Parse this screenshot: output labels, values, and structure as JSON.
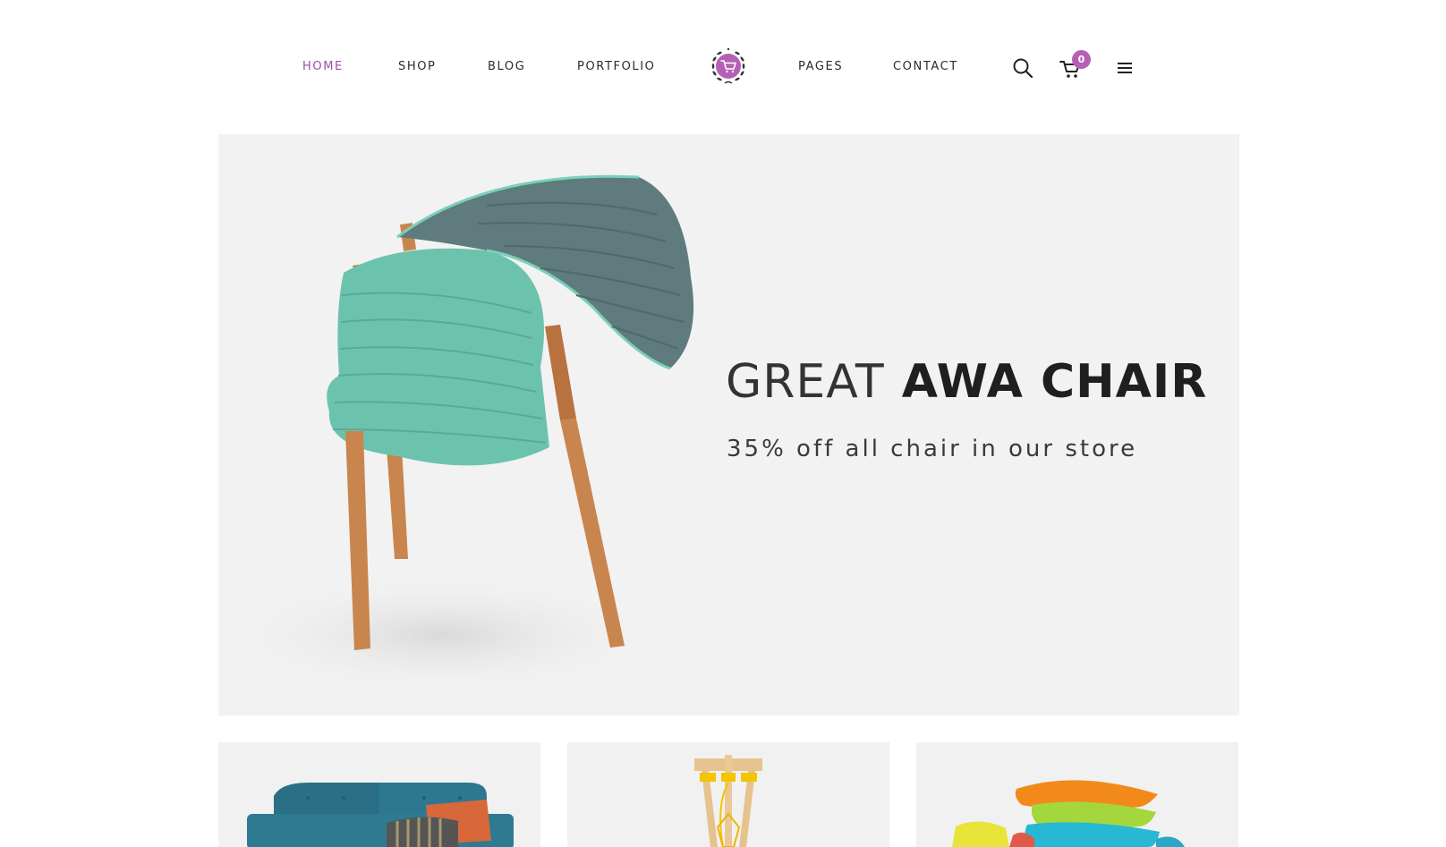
{
  "nav": {
    "left": [
      {
        "label": "HOME",
        "active": true
      },
      {
        "label": "SHOP"
      },
      {
        "label": "BLOG"
      },
      {
        "label": "PORTFOLIO"
      }
    ],
    "right": [
      {
        "label": "PAGES"
      },
      {
        "label": "CONTACT"
      }
    ],
    "logo_icon": "shopping-cart-wreath-logo",
    "icons": [
      "search-icon",
      "cart-icon",
      "hamburger-menu-icon"
    ],
    "cart_count": "0"
  },
  "hero": {
    "title_light": "GREAT",
    "title_bold": "AWA CHAIR",
    "subtitle": "35% off all chair in our store",
    "image": "teal-quilted-chair-with-wooden-legs"
  },
  "cards": [
    {
      "image": "teal-sofa-with-cushions"
    },
    {
      "image": "wooden-tripod-lamp"
    },
    {
      "image": "stack-of-colorful-pillows"
    }
  ],
  "colors": {
    "accent": "#9b4fa3",
    "badge": "#b560b4",
    "text": "#2b2b2b",
    "hero_bg": "#f2f2f2",
    "chair_teal": "#6cc3ad",
    "chair_cover": "#5f7b7d",
    "wood": "#c9854e"
  }
}
